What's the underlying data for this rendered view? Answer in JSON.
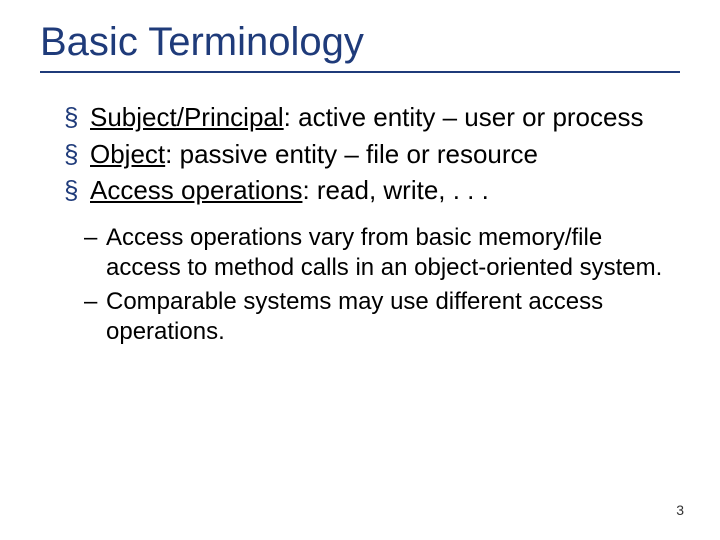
{
  "title": "Basic Terminology",
  "bullets": [
    {
      "term": "Subject/Principal",
      "rest": ": active entity – user or process"
    },
    {
      "term": "Object",
      "rest": ": passive entity – file or resource"
    },
    {
      "term": "Access operations",
      "rest": ": read, write, . . ."
    }
  ],
  "sub_bullets": [
    "Access operations vary from basic memory/file access to method calls in an object-oriented system.",
    "Comparable systems may use different access operations."
  ],
  "page_number": "3"
}
